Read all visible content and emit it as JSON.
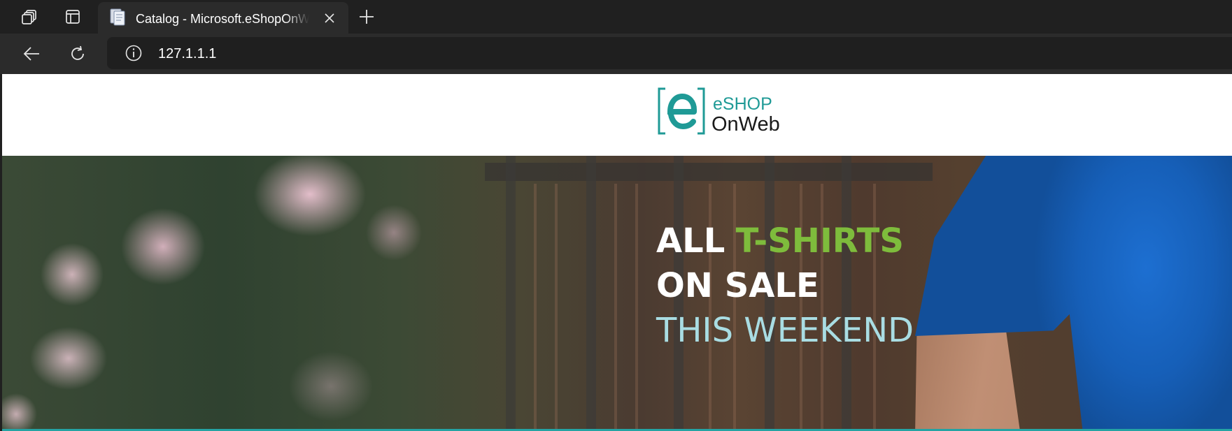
{
  "browser": {
    "tab": {
      "title": "Catalog - Microsoft.eShopOnWeb"
    },
    "address_bar": {
      "url": "127.1.1.1"
    },
    "icons": {
      "workspaces": "workspaces-icon",
      "tab_actions": "tab-actions-icon",
      "tab_favicon": "page-favicon-icon",
      "close_tab": "close-icon",
      "new_tab": "plus-icon",
      "back": "back-arrow-icon",
      "reload": "reload-icon",
      "site_info": "info-icon"
    }
  },
  "site": {
    "logo": {
      "mark": "e",
      "line1": "eSHOP",
      "line2": "OnWeb"
    },
    "hero": {
      "line1_a": "ALL",
      "line1_b": "T-SHIRTS",
      "line2": "ON SALE",
      "line3": "THIS WEEKEND"
    }
  },
  "colors": {
    "brand_teal": "#1f9a96",
    "accent_green": "#7ebc3c",
    "headline_white": "#ffffff",
    "headline_light": "#a9dde3",
    "browser_chrome": "#202020"
  }
}
